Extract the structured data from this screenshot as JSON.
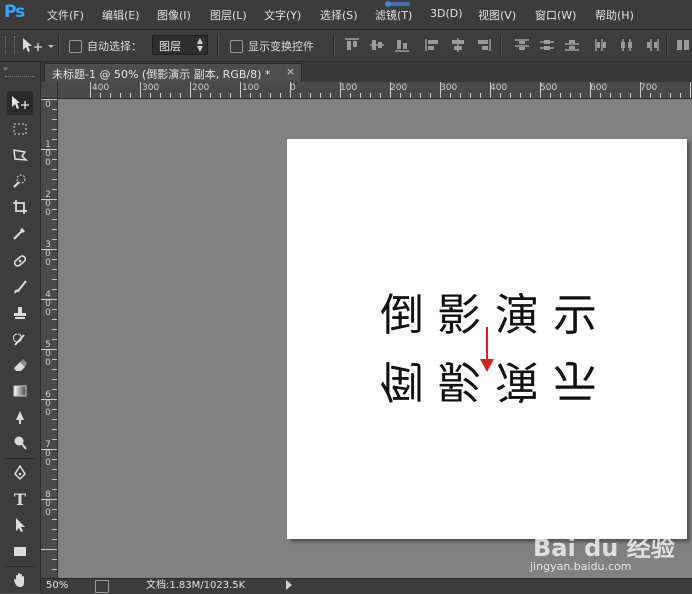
{
  "app": {
    "logo": "Ps"
  },
  "menu": [
    {
      "label": "文件(F)"
    },
    {
      "label": "编辑(E)"
    },
    {
      "label": "图像(I)"
    },
    {
      "label": "图层(L)"
    },
    {
      "label": "文字(Y)"
    },
    {
      "label": "选择(S)"
    },
    {
      "label": "滤镜(T)"
    },
    {
      "label": "3D(D)"
    },
    {
      "label": "视图(V)"
    },
    {
      "label": "窗口(W)"
    },
    {
      "label": "帮助(H)"
    }
  ],
  "options": {
    "auto_select_label": "自动选择：",
    "auto_select_checked": false,
    "auto_select_target": "图层",
    "show_transform_label": "显示变换控件",
    "show_transform_checked": false
  },
  "document_tab": {
    "title": "未标题-1 @ 50% (倒影演示 副本, RGB/8) *",
    "close": "×"
  },
  "ruler_top": [
    "400",
    "300",
    "200",
    "100",
    "0",
    "100",
    "200",
    "300",
    "400",
    "500",
    "600",
    "700"
  ],
  "ruler_left": [
    "0",
    "100",
    "200",
    "300",
    "400",
    "500",
    "600",
    "700",
    "800"
  ],
  "canvas": {
    "text": [
      "倒",
      "影",
      "演",
      "示"
    ],
    "text_color": "#111111",
    "arrow_color": "#d62020"
  },
  "status": {
    "zoom": "50%",
    "doc_info": "文档:1.83M/1023.5K"
  },
  "watermark": {
    "brand": "Bai du 经验",
    "url": "jingyan.baidu.com"
  },
  "colors": {
    "menu_bg": "#3c3c3c",
    "panel_bg": "#3d3d3d",
    "canvas_bg": "#818181",
    "accent": "#31a8ff"
  }
}
